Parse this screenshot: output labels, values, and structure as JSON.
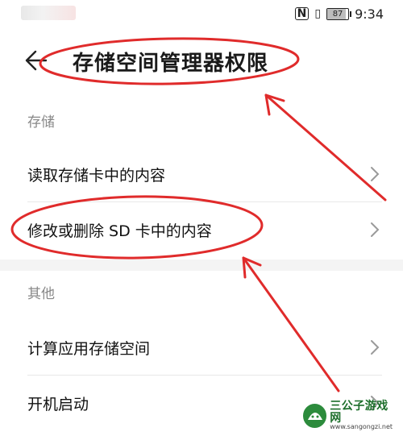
{
  "status_bar": {
    "battery_level": 87,
    "battery_text": "87",
    "time": "9:34",
    "nfc_text": "N"
  },
  "header": {
    "title": "存储空间管理器权限"
  },
  "sections": [
    {
      "title": "存储",
      "items": [
        {
          "label": "读取存储卡中的内容"
        },
        {
          "label": "修改或删除 SD 卡中的内容"
        }
      ]
    },
    {
      "title": "其他",
      "items": [
        {
          "label": "计算应用存储空间"
        },
        {
          "label": "开机启动"
        }
      ]
    }
  ],
  "annotations": {
    "color": "#e02b2b"
  },
  "watermark": {
    "name": "三公子游戏网",
    "url": "www.sangongzi.net"
  }
}
